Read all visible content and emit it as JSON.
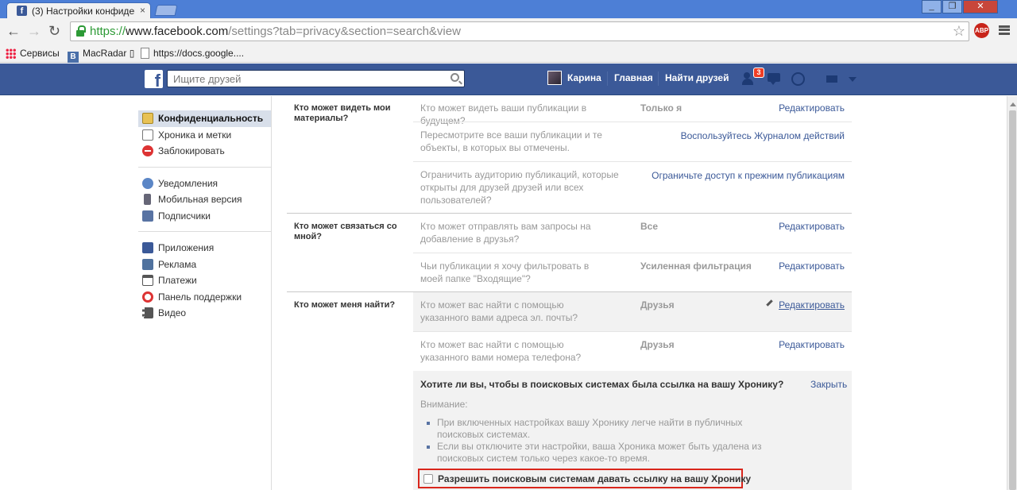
{
  "browser": {
    "tab_title": "(3) Настройки конфиден...",
    "tab_close": "×",
    "url_scheme": "https://",
    "url_host": "www.facebook.com",
    "url_path": "/settings?tab=privacy&section=search&view",
    "abp": "ABP",
    "win_min": "_",
    "win_max": "❐",
    "win_close": "✕",
    "bookmarks": [
      "Сервисы",
      "MacRadar ▯",
      "https://docs.google...."
    ]
  },
  "fbbar": {
    "logo": "f",
    "search_placeholder": "Ищите друзей",
    "user_name": "Карина",
    "home": "Главная",
    "find_friends": "Найти друзей",
    "friend_requests_badge": "3"
  },
  "sidebar": {
    "groups": [
      [
        {
          "label": "Конфиденциальность",
          "icon": "lock-icon",
          "active": true
        },
        {
          "label": "Хроника и метки",
          "icon": "timeline-icon"
        },
        {
          "label": "Заблокировать",
          "icon": "block-icon"
        }
      ],
      [
        {
          "label": "Уведомления",
          "icon": "globe-icon"
        },
        {
          "label": "Мобильная версия",
          "icon": "mobile-icon"
        },
        {
          "label": "Подписчики",
          "icon": "rss-icon"
        }
      ],
      [
        {
          "label": "Приложения",
          "icon": "apps-icon"
        },
        {
          "label": "Реклама",
          "icon": "ads-icon"
        },
        {
          "label": "Платежи",
          "icon": "payment-icon"
        },
        {
          "label": "Панель поддержки",
          "icon": "support-icon"
        },
        {
          "label": "Видео",
          "icon": "video-icon"
        }
      ]
    ]
  },
  "sections": {
    "s1": {
      "title": "Кто может видеть мои материалы?",
      "rows": [
        {
          "q": "Кто может видеть ваши публикации в будущем?",
          "value": "Только я",
          "action": "Редактировать"
        },
        {
          "q": "Пересмотрите все ваши публикации и те объекты, в которых вы отмечены.",
          "value": "",
          "action": "Воспользуйтесь Журналом действий"
        },
        {
          "q": "Ограничить аудиторию публикаций, которые открыты для друзей друзей или всех пользователей?",
          "value": "",
          "action": "Ограничьте доступ к прежним публикациям"
        }
      ]
    },
    "s2": {
      "title": "Кто может связаться со мной?",
      "rows": [
        {
          "q": "Кто может отправлять вам запросы на добавление в друзья?",
          "value": "Все",
          "action": "Редактировать"
        },
        {
          "q": "Чьи публикации я хочу фильтровать в моей папке \"Входящие\"?",
          "value": "Усиленная фильтрация",
          "action": "Редактировать"
        }
      ]
    },
    "s3": {
      "title": "Кто может меня найти?",
      "rows": [
        {
          "q": "Кто может вас найти с помощью указанного вами адреса эл. почты?",
          "value": "Друзья",
          "action": "Редактировать"
        },
        {
          "q": "Кто может вас найти с помощью указанного вами номера телефона?",
          "value": "Друзья",
          "action": "Редактировать"
        }
      ],
      "expanded": {
        "title": "Хотите ли вы, чтобы в поисковых системах была ссылка на вашу Хронику?",
        "close": "Закрыть",
        "note": "Внимание:",
        "bullets": [
          "При включенных настройках вашу Хронику легче найти в публичных поисковых системах.",
          "Если вы отключите эти настройки, ваша Хроника может быть удалена из поисковых систем только через какое-то время."
        ],
        "checkbox_label": "Разрешить поисковым системам давать ссылку на вашу Хронику",
        "checkbox_checked": false
      }
    }
  }
}
